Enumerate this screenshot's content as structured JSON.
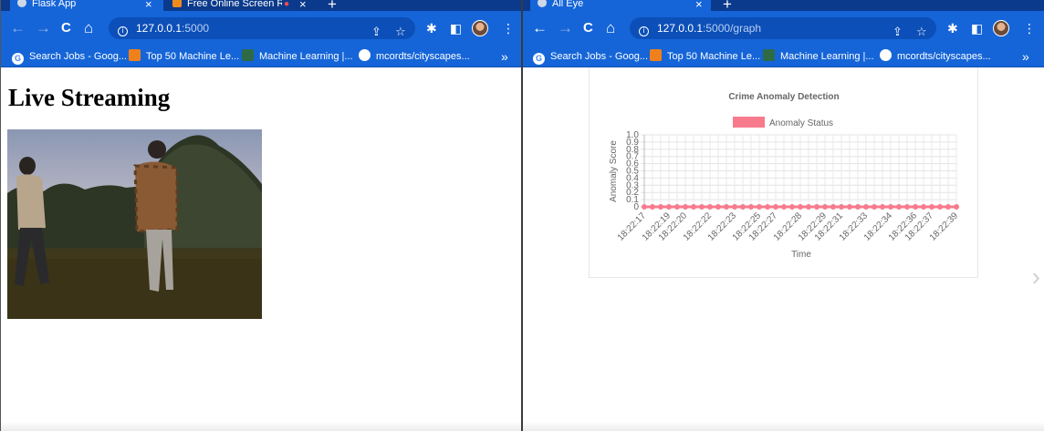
{
  "left_window": {
    "tabs": [
      {
        "title": "Flask App",
        "close": "×"
      },
      {
        "title": "Free Online Screen Re",
        "close": "×"
      }
    ],
    "new_tab": "+",
    "url_host": "127.0.0.1",
    "url_path": ":5000",
    "bookmarks": [
      {
        "label": "Search Jobs - Goog...",
        "icon": "G"
      },
      {
        "label": "Top 50 Machine Le...",
        "icon": "O"
      },
      {
        "label": "Machine Learning |...",
        "icon": "ML"
      },
      {
        "label": "mcordts/cityscapes...",
        "icon": "GH"
      }
    ],
    "more": "»",
    "page_title": "Live Streaming"
  },
  "right_window": {
    "tabs": [
      {
        "title": "All Eye",
        "close": "×"
      }
    ],
    "new_tab": "+",
    "url_host": "127.0.0.1",
    "url_path": ":5000/graph",
    "bookmarks": [
      {
        "label": "Search Jobs - Goog...",
        "icon": "G"
      },
      {
        "label": "Top 50 Machine Le...",
        "icon": "O"
      },
      {
        "label": "Machine Learning |...",
        "icon": "ML"
      },
      {
        "label": "mcordts/cityscapes...",
        "icon": "GH"
      }
    ],
    "more": "»",
    "next_arrow": "›"
  },
  "icons": {
    "back": "←",
    "forward": "→",
    "reload": "C",
    "home": "⌂",
    "info": "i",
    "share": "⇪",
    "star": "☆",
    "extensions": "✱",
    "sidebar": "◧",
    "menu": "⋮"
  },
  "chart_data": {
    "type": "line",
    "title": "Crime Anomaly Detection",
    "xlabel": "Time",
    "ylabel": "Anomaly Score",
    "ylim": [
      0,
      1
    ],
    "y_ticks": [
      "0",
      "0.1",
      "0.2",
      "0.3",
      "0.4",
      "0.5",
      "0.6",
      "0.7",
      "0.8",
      "0.9",
      "1.0"
    ],
    "x_tick_labels": [
      "18:22:17",
      "18:22:19",
      "18:22:20",
      "18:22:22",
      "18:22:23",
      "18:22:25",
      "18:22:27",
      "18:22:28",
      "18:22:29",
      "18:22:31",
      "18:22:33",
      "18:22:34",
      "18:22:36",
      "18:22:37",
      "18:22:39"
    ],
    "series": [
      {
        "name": "Anomaly Status",
        "color": "#f77b8c",
        "values": [
          0,
          0,
          0,
          0,
          0,
          0,
          0,
          0,
          0,
          0,
          0,
          0,
          0,
          0,
          0,
          0,
          0,
          0,
          0,
          0,
          0,
          0,
          0,
          0,
          0,
          0,
          0,
          0,
          0,
          0,
          0,
          0,
          0,
          0,
          0,
          0,
          0,
          0,
          0
        ]
      }
    ],
    "legend": "top",
    "grid": true
  }
}
